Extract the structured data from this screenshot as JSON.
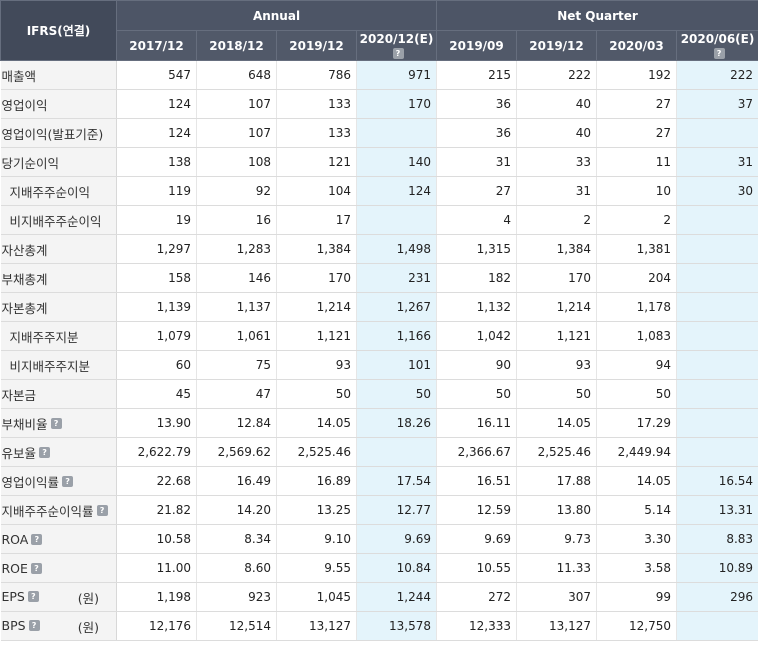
{
  "header": {
    "corner_label": "IFRS(연결)",
    "annual_label": "Annual",
    "quarter_label": "Net Quarter",
    "help_glyph": "?",
    "columns": [
      "2017/12",
      "2018/12",
      "2019/12",
      "2020/12(E)",
      "2019/09",
      "2019/12",
      "2020/03",
      "2020/06(E)"
    ],
    "estimate_columns": [
      3,
      7
    ]
  },
  "rows": [
    {
      "label": "매출액",
      "values": [
        "547",
        "648",
        "786",
        "971",
        "215",
        "222",
        "192",
        "222"
      ]
    },
    {
      "label": "영업이익",
      "values": [
        "124",
        "107",
        "133",
        "170",
        "36",
        "40",
        "27",
        "37"
      ]
    },
    {
      "label": "영업이익(발표기준)",
      "values": [
        "124",
        "107",
        "133",
        "",
        "36",
        "40",
        "27",
        ""
      ]
    },
    {
      "label": "당기순이익",
      "values": [
        "138",
        "108",
        "121",
        "140",
        "31",
        "33",
        "11",
        "31"
      ]
    },
    {
      "label": "지배주주순이익",
      "values": [
        "119",
        "92",
        "104",
        "124",
        "27",
        "31",
        "10",
        "30"
      ]
    },
    {
      "label": "비지배주주순이익",
      "values": [
        "19",
        "16",
        "17",
        "",
        "4",
        "2",
        "2",
        ""
      ]
    },
    {
      "label": "자산총계",
      "values": [
        "1,297",
        "1,283",
        "1,384",
        "1,498",
        "1,315",
        "1,384",
        "1,381",
        ""
      ]
    },
    {
      "label": "부채총계",
      "values": [
        "158",
        "146",
        "170",
        "231",
        "182",
        "170",
        "204",
        ""
      ]
    },
    {
      "label": "자본총계",
      "values": [
        "1,139",
        "1,137",
        "1,214",
        "1,267",
        "1,132",
        "1,214",
        "1,178",
        ""
      ]
    },
    {
      "label": "지배주주지분",
      "values": [
        "1,079",
        "1,061",
        "1,121",
        "1,166",
        "1,042",
        "1,121",
        "1,083",
        ""
      ]
    },
    {
      "label": "비지배주주지분",
      "values": [
        "60",
        "75",
        "93",
        "101",
        "90",
        "93",
        "94",
        ""
      ]
    },
    {
      "label": "자본금",
      "values": [
        "45",
        "47",
        "50",
        "50",
        "50",
        "50",
        "50",
        ""
      ]
    },
    {
      "label": "부채비율",
      "values": [
        "13.90",
        "12.84",
        "14.05",
        "18.26",
        "16.11",
        "14.05",
        "17.29",
        ""
      ]
    },
    {
      "label": "유보율",
      "values": [
        "2,622.79",
        "2,569.62",
        "2,525.46",
        "",
        "2,366.67",
        "2,525.46",
        "2,449.94",
        ""
      ]
    },
    {
      "label": "영업이익률",
      "values": [
        "22.68",
        "16.49",
        "16.89",
        "17.54",
        "16.51",
        "17.88",
        "14.05",
        "16.54"
      ]
    },
    {
      "label": "지배주주순이익률",
      "values": [
        "21.82",
        "14.20",
        "13.25",
        "12.77",
        "12.59",
        "13.80",
        "5.14",
        "13.31"
      ]
    },
    {
      "label": "ROA",
      "values": [
        "10.58",
        "8.34",
        "9.10",
        "9.69",
        "9.69",
        "9.73",
        "3.30",
        "8.83"
      ]
    },
    {
      "label": "ROE",
      "values": [
        "11.00",
        "8.60",
        "9.55",
        "10.84",
        "10.55",
        "11.33",
        "3.58",
        "10.89"
      ]
    },
    {
      "label": "EPS",
      "unit": "(원)",
      "values": [
        "1,198",
        "923",
        "1,045",
        "1,244",
        "272",
        "307",
        "99",
        "296"
      ]
    },
    {
      "label": "BPS",
      "unit": "(원)",
      "values": [
        "12,176",
        "12,514",
        "13,127",
        "13,578",
        "12,333",
        "13,127",
        "12,750",
        ""
      ]
    }
  ]
}
